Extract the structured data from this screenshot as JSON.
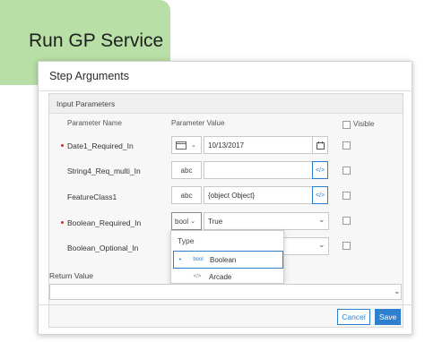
{
  "app_title": "Run GP Service",
  "dialog": {
    "title": "Step Arguments",
    "panel_title": "Input Parameters",
    "columns": {
      "name": "Parameter Name",
      "value": "Parameter Value",
      "visible": "Visible"
    },
    "rows": [
      {
        "name": "Date1_Required_In",
        "required": true,
        "type": "date",
        "value": "10/13/2017"
      },
      {
        "name": "String4_Req_multi_In",
        "required": false,
        "type": "abc",
        "value": ""
      },
      {
        "name": "FeatureClass1",
        "required": false,
        "type": "abc",
        "value": "{object Object}"
      },
      {
        "name": "Boolean_Required_In",
        "required": true,
        "type": "bool",
        "value": "True"
      },
      {
        "name": "Boolean_Optional_In",
        "required": false,
        "type": "bool",
        "value": ""
      }
    ],
    "type_dropdown": {
      "header": "Type",
      "options": [
        {
          "icon": "bool",
          "label": "Boolean",
          "selected": true
        },
        {
          "icon": "</>",
          "label": "Arcade",
          "selected": false
        }
      ]
    },
    "return_value_label": "Return Value",
    "return_value": "",
    "cancel_label": "Cancel",
    "save_label": "Save"
  },
  "icons": {
    "calendar": "calendar-icon",
    "chevron": "chevron-down-icon",
    "code": "code-icon"
  },
  "colors": {
    "title_tab": "#b8dfa6",
    "accent": "#2f7fcf",
    "required": "#c23a2b"
  }
}
